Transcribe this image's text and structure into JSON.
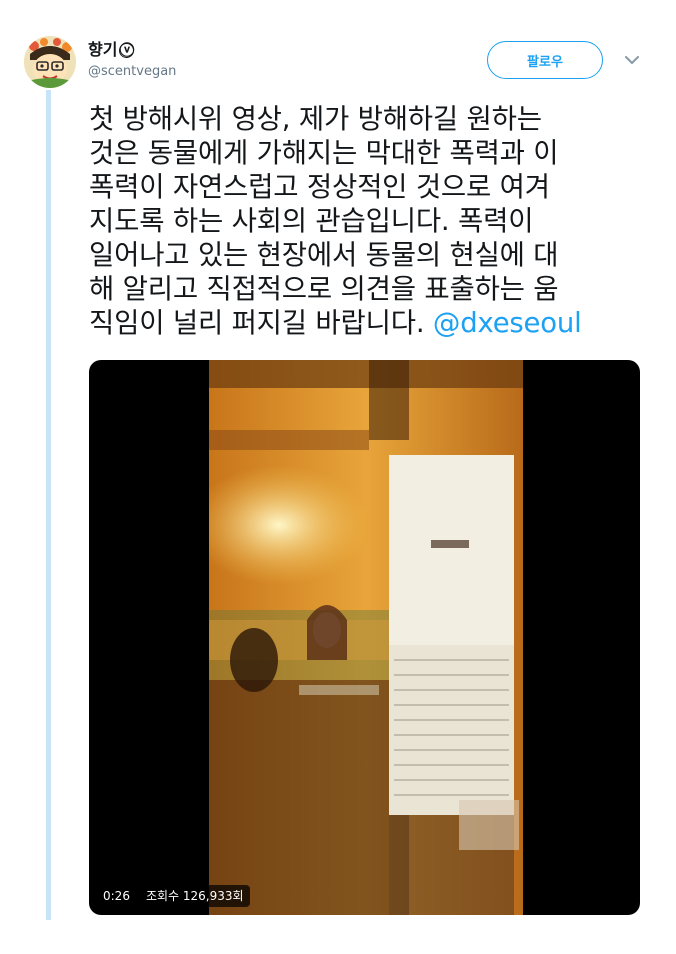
{
  "user": {
    "display_name": "향기",
    "badge_glyph": "ⓥ",
    "handle": "@scentvegan"
  },
  "header": {
    "follow_label": "팔로우"
  },
  "tweet": {
    "lines": [
      "첫 방해시위 영상, 제가 방해하길 원하는",
      "것은 동물에게 가해지는 막대한 폭력과 이",
      "폭력이 자연스럽고 정상적인 것으로 여겨",
      "지도록 하는 사회의 관습입니다. 폭력이",
      "일어나고 있는 현장에서 동물의 현실에 대",
      "해 알리고 직접적으로 의견을 표출하는 움",
      "직임이 널리 퍼지길 바랍니다."
    ],
    "mention": "@dxeseoul"
  },
  "video": {
    "duration": "0:26",
    "views": "조회수 126,933회"
  },
  "icons": {
    "avatar": "avatar-cartoon-icon",
    "more": "chevron-down-icon",
    "badge": "vegan-badge-icon"
  },
  "colors": {
    "link": "#1da1f2",
    "thread_line": "#c7e4f8",
    "handle_gray": "#657786"
  }
}
